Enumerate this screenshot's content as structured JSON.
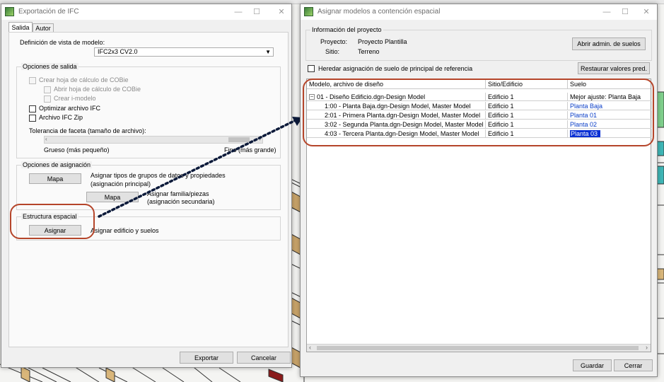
{
  "left_dialog": {
    "title": "Exportación de IFC",
    "tabs": [
      "Salida",
      "Autor"
    ],
    "model_view_label": "Definición de vista de modelo:",
    "model_view_value": "IFC2x3 CV2.0",
    "output_options_label": "Opciones de salida",
    "cobie_create": "Crear hoja de cálculo de COBie",
    "cobie_open": "Abrir hoja de cálculo de COBie",
    "imodel_create": "Crear i-modelo",
    "optimize_ifc": "Optimizar archivo IFC",
    "ifc_zip": "Archivo IFC Zip",
    "facet_label": "Tolerancia de faceta (tamaño de archivo):",
    "facet_coarse": "Grueso (más pequeño)",
    "facet_fine": "Fino (más grande)",
    "assign_options_label": "Opciones de asignación",
    "map_button": "Mapa",
    "map_primary_desc_1": "Asignar tipos de grupos de datos y propiedades",
    "map_primary_desc_2": "(asignación principal)",
    "map_secondary_desc_1": "Asignar familia/piezas",
    "map_secondary_desc_2": "(asignación secundaria)",
    "spatial_label": "Estructura espacial",
    "assign_button": "Asignar",
    "assign_desc": "Asignar edificio y suelos",
    "export_button": "Exportar",
    "cancel_button": "Cancelar"
  },
  "right_dialog": {
    "title": "Asignar modelos a contención espacial",
    "project_info_label": "Información del proyecto",
    "project_label": "Proyecto:",
    "project_value": "Proyecto Plantilla",
    "site_label": "Sitio:",
    "site_value": "Terreno",
    "floor_admin_button": "Abrir admin. de suelos",
    "inherit_label": "Heredar asignación de suelo de principal de referencia",
    "restore_button": "Restaurar valores pred.",
    "columns": [
      "Modelo, archivo de diseño",
      "Sitio/Edificio",
      "Suelo"
    ],
    "rows": [
      {
        "model": "01 - Diseño Edificio.dgn-Design Model",
        "building": "Edificio 1",
        "floor": "Mejor ajuste: Planta Baja"
      },
      {
        "model": "1:00 - Planta Baja.dgn-Design Model, Master Model",
        "building": "Edificio 1",
        "floor": "Planta Baja"
      },
      {
        "model": "2:01 - Primera Planta.dgn-Design Model, Master Model",
        "building": "Edificio 1",
        "floor": "Planta 01"
      },
      {
        "model": "3:02 - Segunda Planta.dgn-Design Model, Master Model",
        "building": "Edificio 1",
        "floor": "Planta 02"
      },
      {
        "model": "4:03 - Tercera Planta.dgn-Design Model, Master Model",
        "building": "Edificio 1",
        "floor": "Planta 03"
      }
    ],
    "expander_glyph": "−",
    "save_button": "Guardar",
    "close_button": "Cerrar"
  },
  "colors": {
    "accent_red": "#b5452a",
    "selection_blue": "#0a30d4",
    "link_blue": "#0a3ec7"
  }
}
